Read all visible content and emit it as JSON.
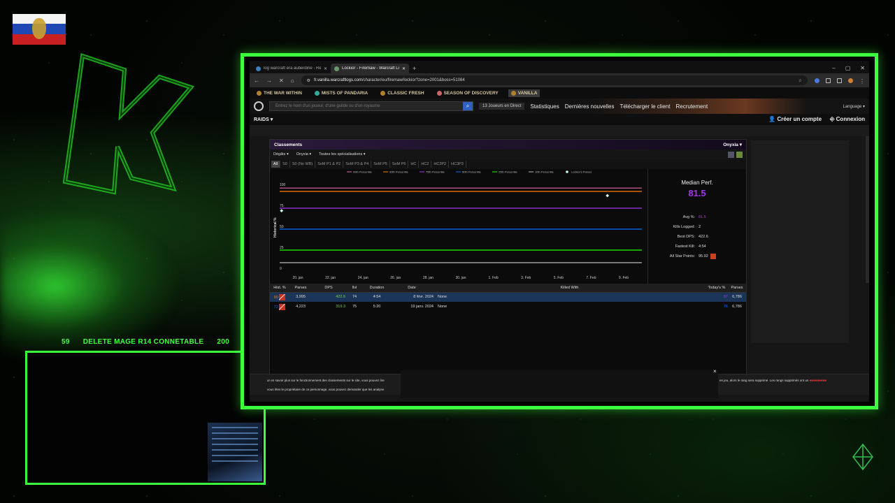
{
  "overlay": {
    "bar_left": "59",
    "bar_text": "DELETE MAGE R14 CONNETABLE",
    "bar_right": "200"
  },
  "browser": {
    "tabs": [
      {
        "title": "log warcraft era auberdine - Re"
      },
      {
        "title": "Lockior - Firemaw - Warcraft Lo"
      }
    ],
    "new_tab": "+",
    "window_controls": [
      "–",
      "▢",
      "✕"
    ],
    "url_host": "fr.vanilla.warcraftlogs.com",
    "url_path": "/character/eu/firemaw/lockior?zone=2001&boss=51084"
  },
  "game_nav": [
    {
      "label": "THE WAR WITHIN"
    },
    {
      "label": "MISTS OF PANDARIA"
    },
    {
      "label": "CLASSIC FRESH"
    },
    {
      "label": "SEASON OF DISCOVERY"
    },
    {
      "label": "VANILLA"
    }
  ],
  "site_header": {
    "search_placeholder": "Entrez le nom d'un joueur, d'une guilde ou d'un royaume",
    "live": "13 Joueurs en Direct",
    "nav": [
      "Statistiques",
      "Dernières nouvelles",
      "Télécharger le client",
      "Recrutement"
    ],
    "language": "Language"
  },
  "subnav": {
    "raids": "RAIDS",
    "create_account": "Créer un compte",
    "login": "Connexion"
  },
  "rankings": {
    "title": "Classements",
    "boss_select": "Onyxia",
    "filters": [
      "Dégâts",
      "Onyxia",
      "Toutes les spécialisations"
    ],
    "partitions": [
      "All",
      "S0",
      "S0 (No WB)",
      "SoM P1 & P2",
      "SoM P3 & P4",
      "SoM P5",
      "SoM P6",
      "HC",
      "HC2",
      "HC2P2",
      "HC3P3"
    ],
    "stats": {
      "median_label": "Median Perf.",
      "median_value": "81.5",
      "avg_label": "Avg %:",
      "avg_value": "81.5",
      "kills_label": "Kills Logged:",
      "kills_value": "2",
      "best_dps_label": "Best DPS:",
      "best_dps_value": "422.6",
      "fastest_label": "Fastest Kill:",
      "fastest_value": "4:54",
      "star_label": "All Star Points:",
      "star_value": "95.92"
    },
    "table": {
      "headers": [
        "Hist. %",
        "Parses",
        "DPS",
        "Ilvl",
        "Duration",
        "Date",
        "Killed With",
        "Today's %",
        "Parses"
      ],
      "rows": [
        {
          "hist": "90",
          "parses": "3,995",
          "dps": "422.6",
          "ilvl": "74",
          "duration": "4:54",
          "date": "8 févr. 2024",
          "killed": "None",
          "today": "87",
          "parses2": "6,786"
        },
        {
          "hist": "72",
          "parses": "4,223",
          "dps": "319.3",
          "ilvl": "75",
          "duration": "5:20",
          "date": "19 janv. 2024",
          "killed": "None",
          "today": "76",
          "parses2": "6,786"
        }
      ]
    }
  },
  "chart_data": {
    "type": "line",
    "ylabel": "Historical %",
    "ylim": [
      0,
      100
    ],
    "yticks": [
      0,
      25,
      50,
      75,
      100
    ],
    "categories": [
      "20. jan",
      "22. jan",
      "24. jan",
      "26. jan",
      "28. jan",
      "30. jan",
      "1. Feb",
      "3. Feb",
      "5. Feb",
      "7. Feb",
      "9. Feb"
    ],
    "legend": [
      "99th Percentile",
      "95th Percentile",
      "75th Percentile",
      "50th Percentile",
      "25th Percentile",
      "10th Percentile",
      "Lockior's Parses"
    ],
    "series": [
      {
        "name": "99th Percentile",
        "color": "#e268a8",
        "values": [
          99,
          99,
          99,
          99,
          99,
          99,
          99,
          99,
          99,
          99,
          99
        ]
      },
      {
        "name": "95th Percentile",
        "color": "#ff8000",
        "values": [
          95,
          95,
          95,
          95,
          95,
          95,
          95,
          95,
          95,
          95,
          95
        ]
      },
      {
        "name": "75th Percentile",
        "color": "#a335ee",
        "values": [
          75,
          75,
          75,
          75,
          75,
          75,
          75,
          75,
          75,
          75,
          75
        ]
      },
      {
        "name": "50th Percentile",
        "color": "#0070ff",
        "values": [
          50,
          50,
          50,
          50,
          50,
          50,
          50,
          50,
          50,
          50,
          50
        ]
      },
      {
        "name": "25th Percentile",
        "color": "#1eff00",
        "values": [
          25,
          25,
          25,
          25,
          25,
          25,
          25,
          25,
          25,
          25,
          25
        ]
      },
      {
        "name": "10th Percentile",
        "color": "#bbbbbb",
        "values": [
          10,
          10,
          10,
          10,
          10,
          10,
          10,
          10,
          10,
          10,
          10
        ]
      }
    ],
    "points": [
      {
        "name": "Lockior's Parses",
        "x": "19. jan",
        "y": 72
      },
      {
        "name": "Lockior's Parses",
        "x": "8. Feb",
        "y": 90
      }
    ]
  },
  "cookie_banner": {
    "line1": "ur en savoir plus sur le fonctionnement des classements sur le site, vous pouvez lire",
    "line2": "vous êtes le propriétaire de ce personnage, vous pouvez demander que les analyse",
    "line3": "en jeu, alors le rang sera supprimé. Les rangs supprimés ont un",
    "close": "×"
  }
}
